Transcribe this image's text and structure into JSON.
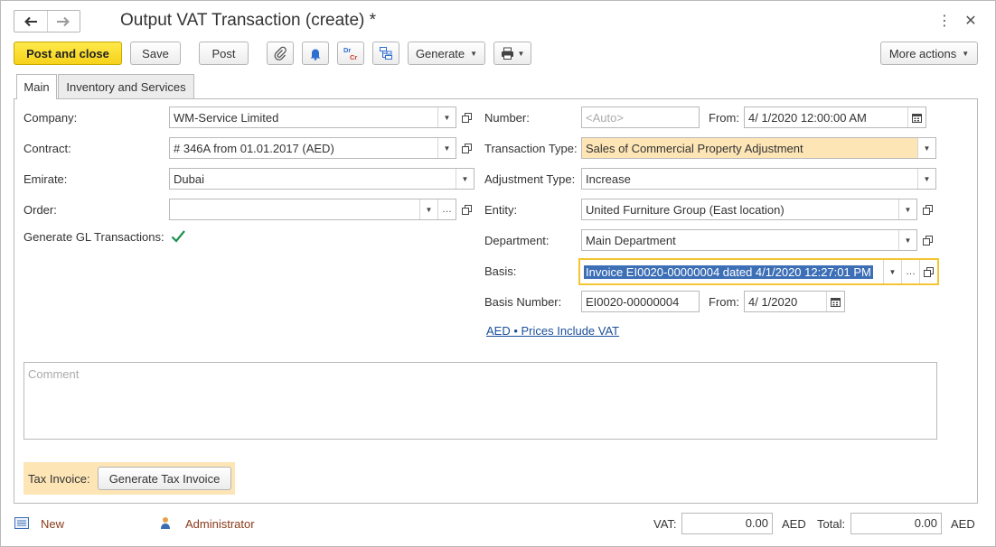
{
  "window": {
    "title": "Output VAT Transaction (create) *",
    "menu_icon": "more-vertical-icon",
    "close_icon": "close-icon"
  },
  "nav": {
    "back_icon": "arrow-left-icon",
    "forward_icon": "arrow-right-icon"
  },
  "toolbar": {
    "post_and_close": "Post and close",
    "save": "Save",
    "post": "Post",
    "attach_icon": "paperclip-icon",
    "reminder_icon": "bell-icon",
    "dr_cr_icon": "dr-cr-icon",
    "structure_icon": "document-structure-icon",
    "generate": "Generate",
    "print_icon": "printer-icon",
    "more_actions": "More actions"
  },
  "tabs": [
    {
      "label": "Main",
      "active": true
    },
    {
      "label": "Inventory and Services",
      "active": false
    }
  ],
  "left": {
    "company": {
      "label": "Company:",
      "value": "WM-Service Limited"
    },
    "contract": {
      "label": "Contract:",
      "value": "# 346A from 01.01.2017 (AED)"
    },
    "emirate": {
      "label": "Emirate:",
      "value": "Dubai"
    },
    "order": {
      "label": "Order:",
      "value": ""
    },
    "generate_gl": {
      "label": "Generate GL Transactions:",
      "checked": true
    }
  },
  "right": {
    "number": {
      "label": "Number:",
      "placeholder": "<Auto>"
    },
    "from": {
      "label": "From:",
      "value": "4/ 1/2020 12:00:00 AM"
    },
    "transaction_type": {
      "label": "Transaction Type:",
      "value": "Sales of Commercial Property Adjustment"
    },
    "adjustment_type": {
      "label": "Adjustment Type:",
      "value": "Increase"
    },
    "entity": {
      "label": "Entity:",
      "value": "United Furniture Group (East location)"
    },
    "department": {
      "label": "Department:",
      "value": "Main Department"
    },
    "basis": {
      "label": "Basis:",
      "value": "Invoice EI0020-00000004 dated 4/1/2020 12:27:01 PM"
    },
    "basis_number": {
      "label": "Basis Number:",
      "value": "EI0020-00000004"
    },
    "basis_from": {
      "label": "From:",
      "value": "4/ 1/2020"
    },
    "currency_link": "AED • Prices Include VAT"
  },
  "comment": {
    "placeholder": "Comment"
  },
  "tax_invoice": {
    "label": "Tax Invoice:",
    "button": "Generate Tax Invoice"
  },
  "status_bar": {
    "new_label": "New",
    "user": "Administrator",
    "vat_label": "VAT:",
    "vat_value": "0.00",
    "vat_currency": "AED",
    "total_label": "Total:",
    "total_value": "0.00",
    "total_currency": "AED"
  },
  "colors": {
    "primary_button": "#f6d21a",
    "highlight_field": "#fde5b6",
    "focus_border": "#f4c531",
    "selection": "#3d6fb6",
    "link": "#1a4e99",
    "status_accent": "#8b3a1a"
  }
}
